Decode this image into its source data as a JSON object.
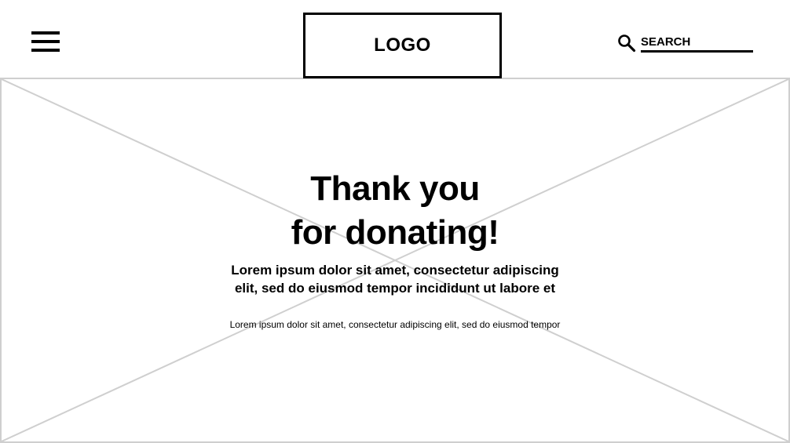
{
  "header": {
    "logo": "LOGO",
    "menu_icon": "hamburger-menu-icon",
    "search": {
      "icon": "search-icon",
      "placeholder": "SEARCH"
    }
  },
  "hero": {
    "image_placeholder": "image-placeholder",
    "title_line1": "Thank you",
    "title_line2": "for donating!",
    "lead_line1": "Lorem ipsum dolor sit amet, consectetur adipiscing",
    "lead_line2": "elit, sed do eiusmod tempor incididunt ut labore et",
    "small_text": "Lorem ipsum dolor sit amet, consectetur adipiscing elit, sed do eiusmod tempor"
  },
  "colors": {
    "text": "#000000",
    "placeholder_lines": "#cfcfcf",
    "background": "#ffffff"
  }
}
